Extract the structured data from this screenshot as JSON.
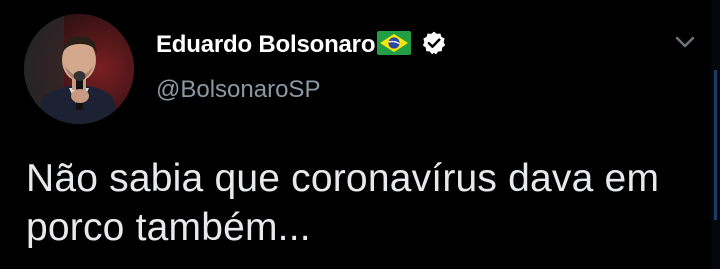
{
  "tweet": {
    "author": {
      "display_name": "Eduardo Bolsonaro",
      "handle": "@BolsonaroSP",
      "flag_icon": "brazil-flag-icon",
      "verified_icon": "verified-badge-icon",
      "avatar_icon": "profile-avatar"
    },
    "menu_icon": "chevron-down-icon",
    "text": "Não sabia que coronavírus dava em porco também..."
  },
  "colors": {
    "background": "#000000",
    "text_primary": "#e7e9ea",
    "text_secondary": "#8b98a5",
    "verified_badge": "#ffffff"
  }
}
